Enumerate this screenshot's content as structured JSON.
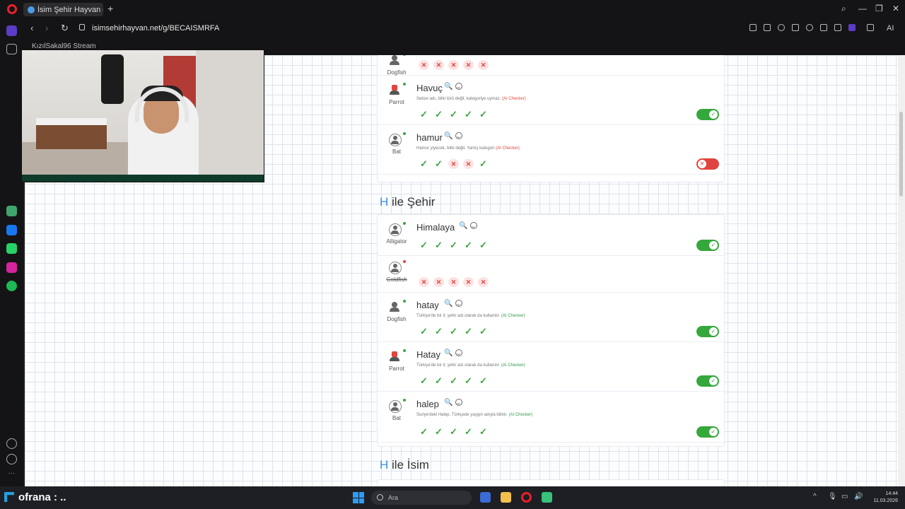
{
  "browser": {
    "tab_title": "İsim Şehir Hayvan oyunu",
    "url": "isimsehirhayvan.net/g/BECAISMRFA",
    "bookmark": "KızılSakal96 Stream",
    "ai_label": "AI"
  },
  "sections": [
    {
      "letter": "H",
      "title": "ile Şehir"
    },
    {
      "letter": "H",
      "title": "ile İsim"
    }
  ],
  "top_card": [
    {
      "player": "Dogfish",
      "word": "",
      "reason": "",
      "tag": "",
      "marks": [
        "x",
        "x",
        "x",
        "x",
        "x"
      ],
      "valid": null
    },
    {
      "player": "Parrot",
      "word": "Havuç",
      "reason": "Sebze adı, bitki türü değil; kategoriye uymaz.",
      "tag": "(AI Checker)",
      "marks": [
        "ok",
        "ok",
        "ok",
        "ok",
        "ok"
      ],
      "valid": true
    },
    {
      "player": "Bat",
      "word": "hamur",
      "reason": "Hamur yiyecek, bitki değil. Yanlış kategori",
      "tag": "(AI Checker)",
      "marks": [
        "ok",
        "ok",
        "x",
        "x",
        "ok"
      ],
      "valid": false
    }
  ],
  "city_card": [
    {
      "player": "Alligator",
      "word": "Himalaya",
      "reason": "",
      "tag": "",
      "marks": [
        "ok",
        "ok",
        "ok",
        "ok",
        "ok"
      ],
      "valid": true
    },
    {
      "player": "Goldfish",
      "word": "",
      "reason": "",
      "tag": "",
      "marks": [
        "x",
        "x",
        "x",
        "x",
        "x"
      ],
      "valid": null
    },
    {
      "player": "Dogfish",
      "word": "hatay",
      "reason": "Türkiye'de bir il; şehir adı olarak da kullanılır.",
      "tag": "(AI Checker)",
      "marks": [
        "ok",
        "ok",
        "ok",
        "ok",
        "ok"
      ],
      "valid": true
    },
    {
      "player": "Parrot",
      "word": "Hatay",
      "reason": "Türkiye'de bir il; şehir adı olarak da kullanılır.",
      "tag": "(AI Checker)",
      "marks": [
        "ok",
        "ok",
        "ok",
        "ok",
        "ok"
      ],
      "valid": true
    },
    {
      "player": "Bat",
      "word": "halep",
      "reason": "Suriye'deki Halep, Türkçede yaygın adıyla bilinir.",
      "tag": "(AI Checker)",
      "marks": [
        "ok",
        "ok",
        "ok",
        "ok",
        "ok"
      ],
      "valid": true
    }
  ],
  "taskbar": {
    "left_label": "ofrana : ..",
    "search_placeholder": "Ara",
    "time": "14:44",
    "date": "11.03.2026"
  }
}
